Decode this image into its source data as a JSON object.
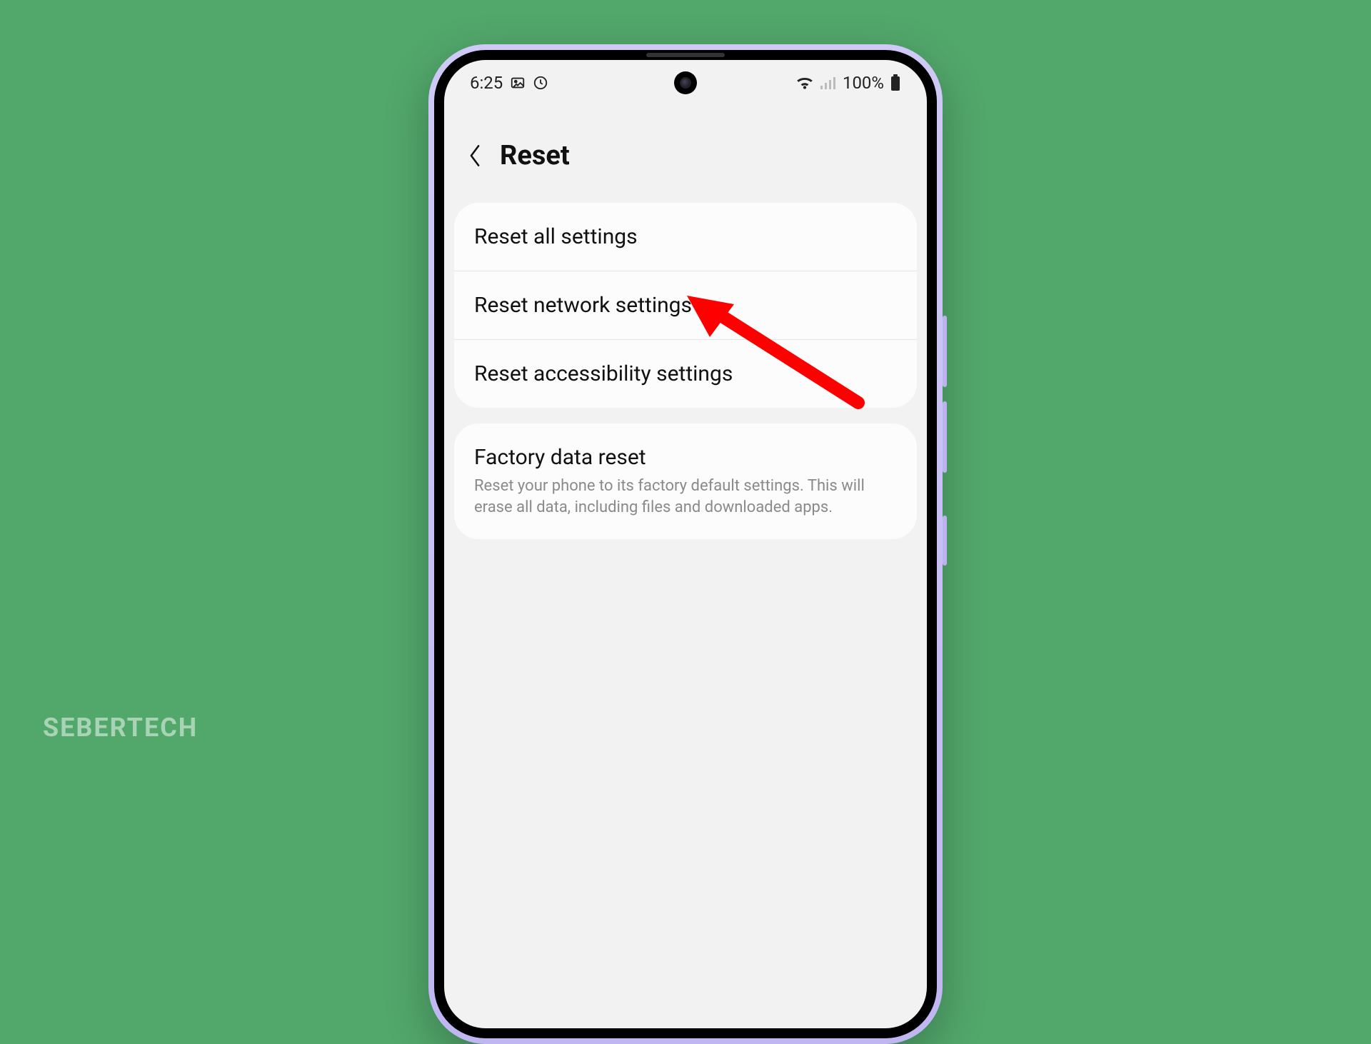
{
  "watermark": "SEBERTECH",
  "status": {
    "time": "6:25",
    "battery_text": "100%"
  },
  "header": {
    "title": "Reset"
  },
  "group1": {
    "items": [
      {
        "label": "Reset all settings"
      },
      {
        "label": "Reset network settings"
      },
      {
        "label": "Reset accessibility settings"
      }
    ]
  },
  "group2": {
    "title": "Factory data reset",
    "subtitle": "Reset your phone to its factory default settings. This will erase all data, including files and downloaded apps."
  },
  "annotation": {
    "arrow_color": "#ff0000"
  }
}
